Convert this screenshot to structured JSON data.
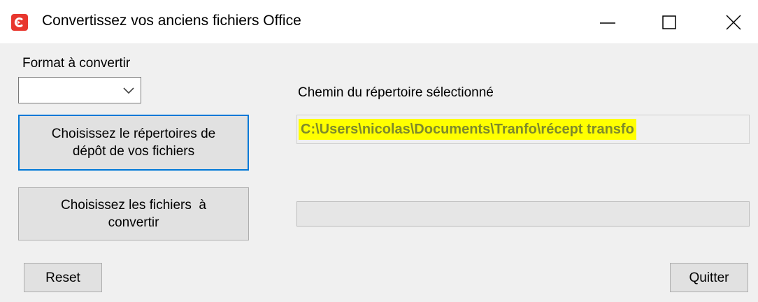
{
  "window": {
    "title": "Convertissez vos anciens fichiers Office",
    "controls": {
      "minimize": "minimize",
      "maximize": "maximize",
      "close": "close"
    }
  },
  "colors": {
    "app_icon": "#e8372e",
    "focus_border": "#0078d7",
    "path_highlight": "#ffff00",
    "path_text": "#7e8a2a"
  },
  "form": {
    "format_label": "Format à convertir",
    "format_value": "",
    "choose_folder_button": [
      "Choisissez le répertoires de",
      "dépôt de vos fichiers"
    ],
    "choose_files_button": [
      "Choisissez les fichiers  à",
      "convertir"
    ],
    "path_label": "Chemin du répertoire sélectionné",
    "path_value": "C:\\Users\\nicolas\\Documents\\Tranfo\\récept transfo",
    "progress": 0,
    "reset_button": "Reset",
    "quit_button": "Quitter"
  }
}
